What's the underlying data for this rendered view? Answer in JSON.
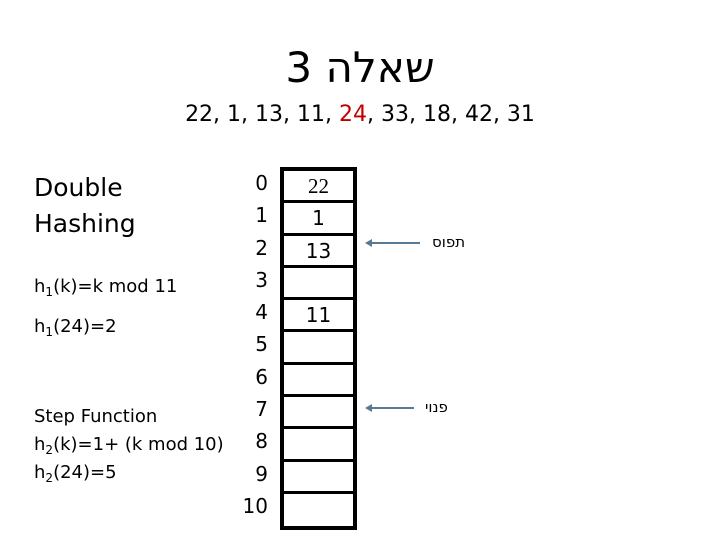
{
  "title": "שאלה 3",
  "sequence": {
    "before": "22, 1, 13, 11, ",
    "highlight": "24",
    "after": ", 33, 18, 42, 31",
    "highlight_color": "#c00000"
  },
  "left_panel": {
    "heading_line1": "Double",
    "heading_line2": "Hashing",
    "h1_def": {
      "fn": "h",
      "sub": "1",
      "rest": "(k)=k mod 11"
    },
    "h1_val": {
      "fn": "h",
      "sub": "1",
      "rest": "(24)=2"
    },
    "step_label": "Step Function",
    "h2_def": {
      "fn": "h",
      "sub": "2",
      "rest": "(k)=1+ (k mod 10)"
    },
    "h2_val": {
      "fn": "h",
      "sub": "2",
      "rest": "(24)=5"
    }
  },
  "hash_table": {
    "indices": [
      "0",
      "1",
      "2",
      "3",
      "4",
      "5",
      "6",
      "7",
      "8",
      "9",
      "10"
    ],
    "cells": [
      "22",
      "1",
      "13",
      "",
      "11",
      "",
      "",
      "",
      "",
      "",
      ""
    ]
  },
  "annotations": [
    {
      "label": "תפוס",
      "points_to_index": 2
    },
    {
      "label": "פנוי",
      "points_to_index": 7
    }
  ],
  "arrow_color": "#5a7a94"
}
